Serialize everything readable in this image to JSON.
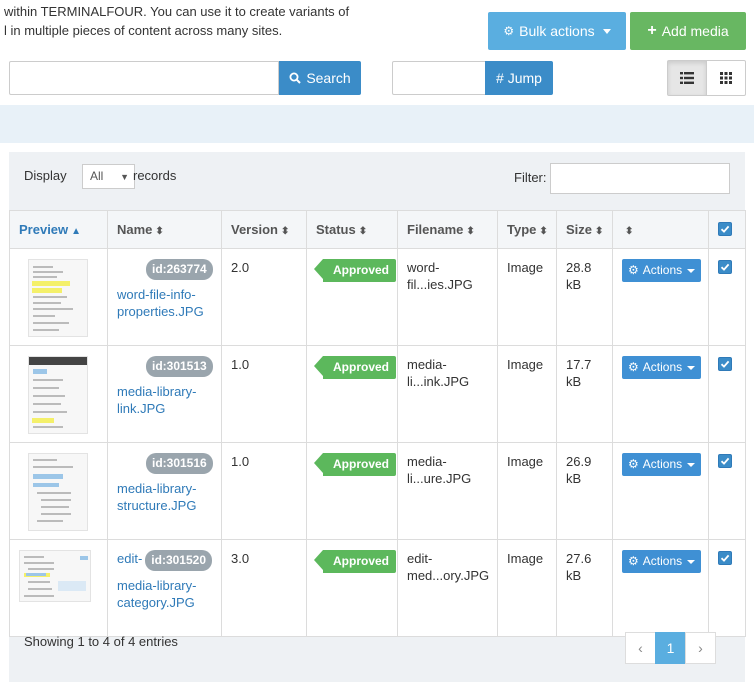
{
  "intro": {
    "line1": "within TERMINALFOUR. You can use it to create variants of",
    "line2": "l in multiple pieces of content across many sites."
  },
  "toolbar": {
    "bulk_label": "Bulk actions",
    "add_label": "Add media",
    "search_label": "Search",
    "search_value": "",
    "jump_label": "# Jump",
    "jump_value": ""
  },
  "table_controls": {
    "display_label": "Display",
    "display_value": "All",
    "records_label": "records",
    "filter_label": "Filter:",
    "filter_value": ""
  },
  "columns": [
    "Preview",
    "Name",
    "Version",
    "Status",
    "Filename",
    "Type",
    "Size"
  ],
  "rows": [
    {
      "id": "id:263774",
      "name_a": "word-file-info-",
      "name_b": "properties.JPG",
      "name_c": "",
      "version": "2.0",
      "status": "Approved",
      "filename_a": "word-",
      "filename_b": "fil...ies.JPG",
      "type": "Image",
      "size_a": "28.8",
      "size_b": "kB",
      "actions": "Actions"
    },
    {
      "id": "id:301513",
      "name_a": "media-library-",
      "name_b": "link.JPG",
      "name_c": "",
      "version": "1.0",
      "status": "Approved",
      "filename_a": "media-",
      "filename_b": "li...ink.JPG",
      "type": "Image",
      "size_a": "17.7",
      "size_b": "kB",
      "actions": "Actions"
    },
    {
      "id": "id:301516",
      "name_a": "media-library-",
      "name_b": "structure.JPG",
      "name_c": "",
      "version": "1.0",
      "status": "Approved",
      "filename_a": "media-",
      "filename_b": "li...ure.JPG",
      "type": "Image",
      "size_a": "26.9",
      "size_b": "kB",
      "actions": "Actions"
    },
    {
      "id": "id:301520",
      "name_a": "edit-",
      "name_b": "media-library-",
      "name_c": "category.JPG",
      "version": "3.0",
      "status": "Approved",
      "filename_a": "edit-",
      "filename_b": "med...ory.JPG",
      "type": "Image",
      "size_a": "27.6",
      "size_b": "kB",
      "actions": "Actions"
    }
  ],
  "footer": {
    "info": "Showing 1 to 4 of 4 entries",
    "prev": "‹",
    "page": "1",
    "next": "›"
  },
  "colors": {
    "bulk": "#5aaee0",
    "add": "#68b762",
    "primary": "#3b8cc8",
    "approved": "#5cb85c",
    "badge": "#9aa5ad"
  }
}
